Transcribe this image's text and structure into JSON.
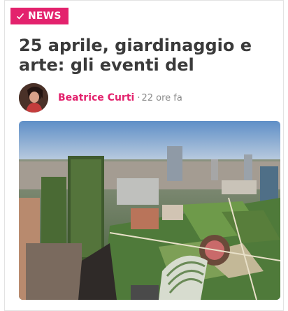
{
  "badge": {
    "label": "NEWS",
    "icon": "check-icon",
    "color": "#e3226d"
  },
  "article": {
    "title": "25 aprile, giardinaggio e arte: gli eventi del"
  },
  "author": {
    "name": "Beatrice Curti",
    "separator": "·",
    "time": "22 ore fa"
  },
  "colors": {
    "accent": "#e3226d",
    "title": "#3a3a3a",
    "meta": "#8a8a8a"
  }
}
